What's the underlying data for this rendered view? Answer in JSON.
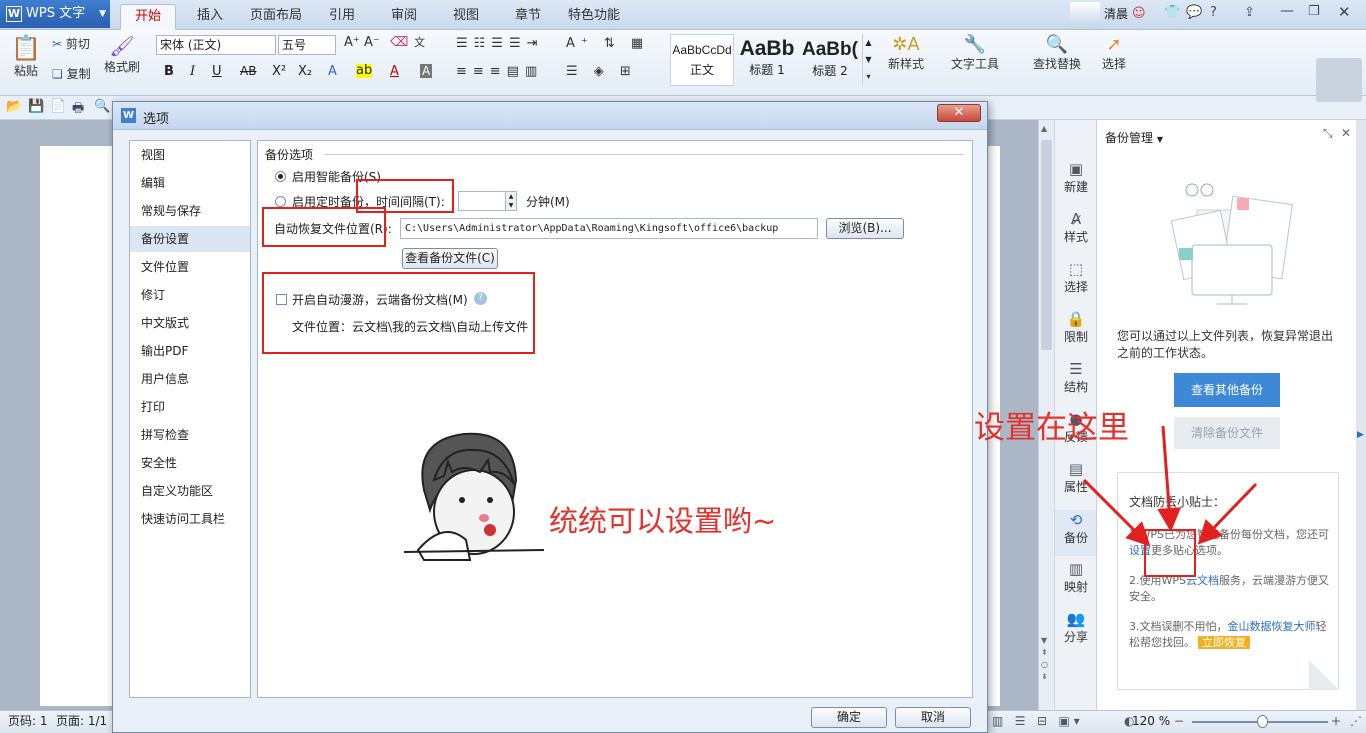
{
  "app": {
    "logo_letter": "W",
    "title": "WPS 文字"
  },
  "tabs": [
    {
      "label": "开始"
    },
    {
      "label": "插入"
    },
    {
      "label": "页面布局"
    },
    {
      "label": "引用"
    },
    {
      "label": "审阅"
    },
    {
      "label": "视图"
    },
    {
      "label": "章节"
    },
    {
      "label": "特色功能"
    }
  ],
  "user": {
    "name": "清晨"
  },
  "ribbon": {
    "paste": "粘贴",
    "cut": "剪切",
    "copy": "复制",
    "format_painter": "格式刷",
    "font_name": "宋体 (正文)",
    "font_size": "五号",
    "styles": [
      {
        "preview": "AaBbCcDd",
        "name": "正文"
      },
      {
        "preview": "AaBb",
        "name": "标题 1"
      },
      {
        "preview": "AaBb(",
        "name": "标题 2"
      }
    ],
    "new_style": "新样式",
    "text_tools": "文字工具",
    "find_replace": "查找替换",
    "select": "选择"
  },
  "dialog": {
    "title": "选项",
    "nav": [
      "视图",
      "编辑",
      "常规与保存",
      "备份设置",
      "文件位置",
      "修订",
      "中文版式",
      "输出PDF",
      "用户信息",
      "打印",
      "拼写检查",
      "安全性",
      "自定义功能区",
      "快速访问工具栏"
    ],
    "selected_nav": "备份设置",
    "section_title": "备份选项",
    "smart_backup": "启用智能备份(S)",
    "timed_backup": "启用定时备份，时间间隔(T):",
    "interval_unit": "分钟(M)",
    "recovery_label": "自动恢复文件位置(R):",
    "recovery_path": "C:\\Users\\Administrator\\AppData\\Roaming\\Kingsoft\\office6\\backup",
    "browse": "浏览(B)...",
    "view_backup": "查看备份文件(C)",
    "roaming_label": "开启自动漫游，云端备份文档(M)",
    "roaming_location": "文件位置：云文档\\我的云文档\\自动上传文件",
    "ok": "确定",
    "cancel": "取消"
  },
  "annotations": {
    "meme_caption": "统统可以设置哟~",
    "pointer_caption": "设置在这里"
  },
  "side_nav": [
    {
      "label": "新建",
      "icon": "new-icon"
    },
    {
      "label": "样式",
      "icon": "style-icon"
    },
    {
      "label": "选择",
      "icon": "select-icon"
    },
    {
      "label": "限制",
      "icon": "lock-icon"
    },
    {
      "label": "结构",
      "icon": "structure-icon"
    },
    {
      "label": "反馈",
      "icon": "feedback-icon"
    },
    {
      "label": "属性",
      "icon": "property-icon"
    },
    {
      "label": "备份",
      "icon": "backup-icon"
    },
    {
      "label": "映射",
      "icon": "map-icon"
    },
    {
      "label": "分享",
      "icon": "share-icon"
    }
  ],
  "task_pane": {
    "title": "备份管理",
    "desc": "您可以通过以上文件列表，恢复异常退出之前的工作状态。",
    "view_other": "查看其他备份",
    "clear": "清除备份文件",
    "tips_title": "文档防丢小贴士：",
    "tip1_a": "1.WPS已为您智能备份每份文档，您还可",
    "tip1_link": "设置",
    "tip1_b": "更多贴心选项。",
    "tip2_a": "2.使用WPS",
    "tip2_link": "云文档",
    "tip2_b": "服务，云端漫游方便又安全。",
    "tip3_a": "3.文档误删不用怕，",
    "tip3_link": "金山数据恢复大师",
    "tip3_b": "轻松帮您找回。",
    "tip3_btn": "立即恢复"
  },
  "status": {
    "page_no": "页码: 1",
    "pages": "页面: 1/1",
    "zoom": "120 %"
  }
}
